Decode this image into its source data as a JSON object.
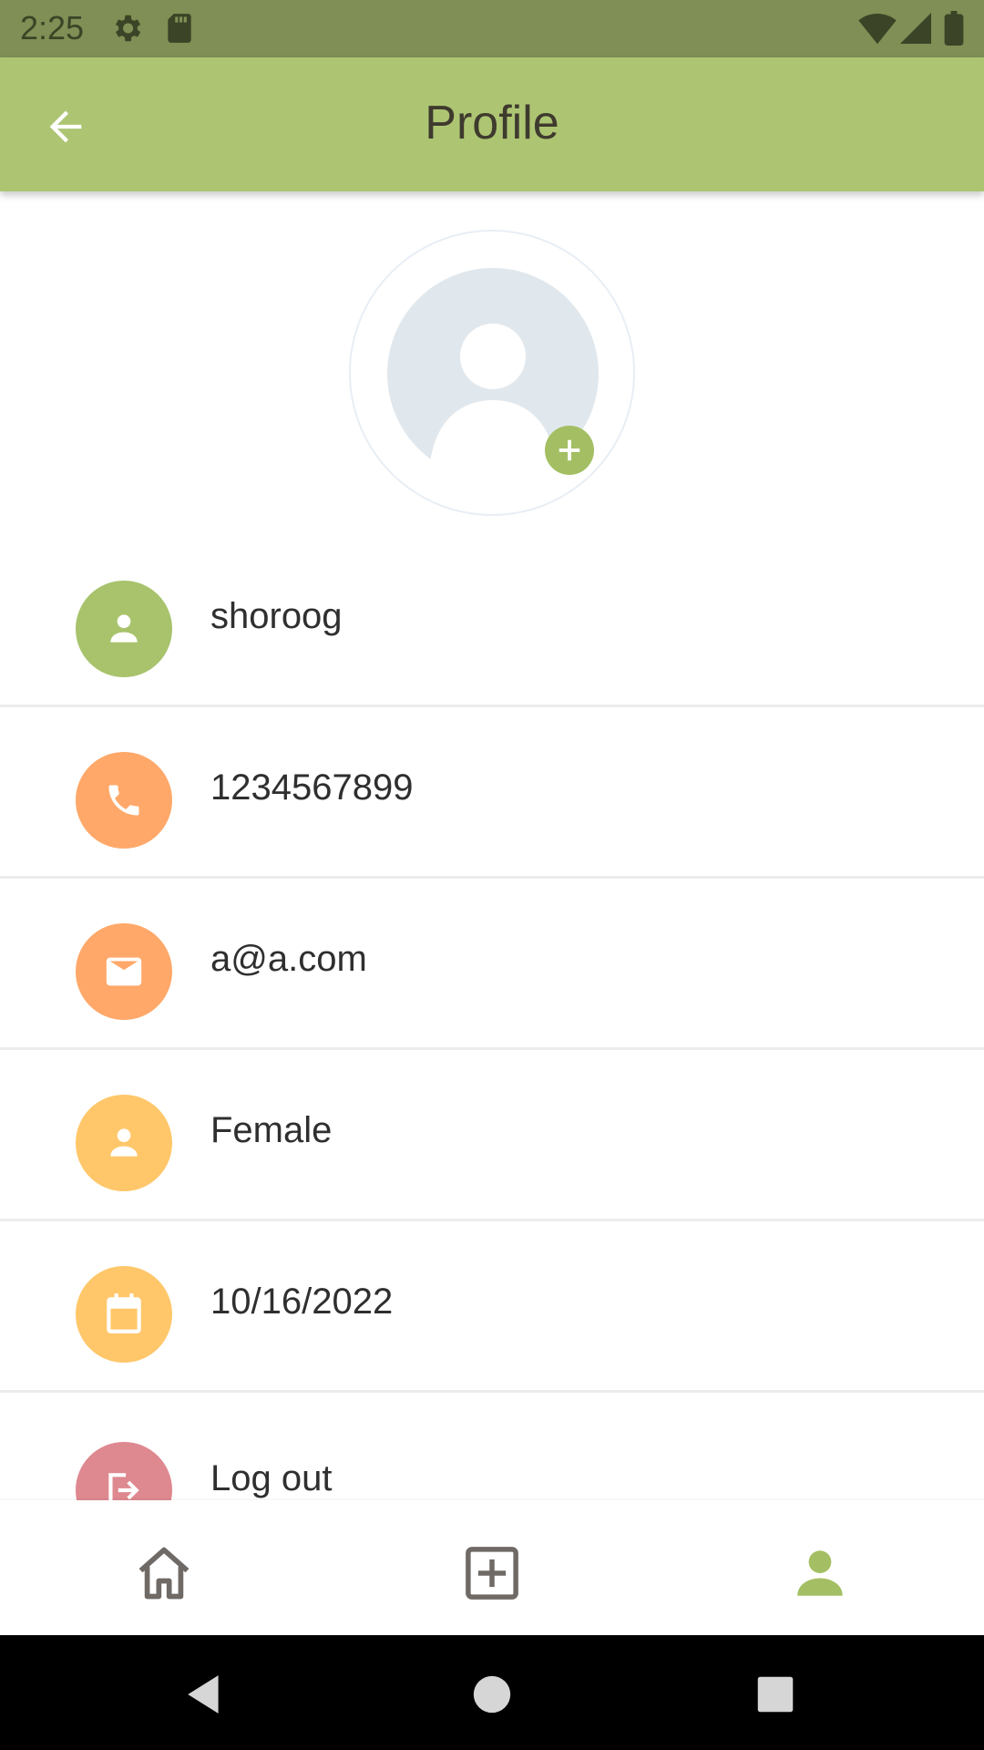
{
  "status_bar": {
    "time": "2:25",
    "icons": [
      "settings-icon",
      "sd-card-icon",
      "wifi-icon",
      "signal-icon",
      "battery-icon"
    ]
  },
  "app_bar": {
    "title": "Profile",
    "back_icon": "arrow-back-icon"
  },
  "profile": {
    "avatar_icon": "person-placeholder-icon",
    "add_photo_icon": "plus-icon",
    "fields": [
      {
        "value": "shoroog",
        "icon": "person-icon",
        "color": "#a8c36c"
      },
      {
        "value": "1234567899",
        "icon": "phone-icon",
        "color": "#ffa869"
      },
      {
        "value": "a@a.com",
        "icon": "email-icon",
        "color": "#ffa869"
      },
      {
        "value": "Female",
        "icon": "person-icon",
        "color": "#ffc76a"
      },
      {
        "value": "10/16/2022",
        "icon": "calendar-icon",
        "color": "#ffc76a"
      }
    ],
    "logout": {
      "label": "Log out",
      "icon": "logout-icon",
      "color": "#de8890"
    }
  },
  "bottom_nav": {
    "items": [
      {
        "name": "home",
        "icon": "home-icon",
        "active": false
      },
      {
        "name": "add",
        "icon": "add-box-icon",
        "active": false
      },
      {
        "name": "profile",
        "icon": "person-icon",
        "active": true
      }
    ],
    "active_color": "#a4bf63",
    "inactive_color": "#6f6a66"
  },
  "system_nav": [
    "back-triangle-icon",
    "home-circle-icon",
    "recents-square-icon"
  ],
  "colors": {
    "app_bar": "#adc572",
    "status_bar": "#7f8f55",
    "accent": "#a4bf63"
  }
}
